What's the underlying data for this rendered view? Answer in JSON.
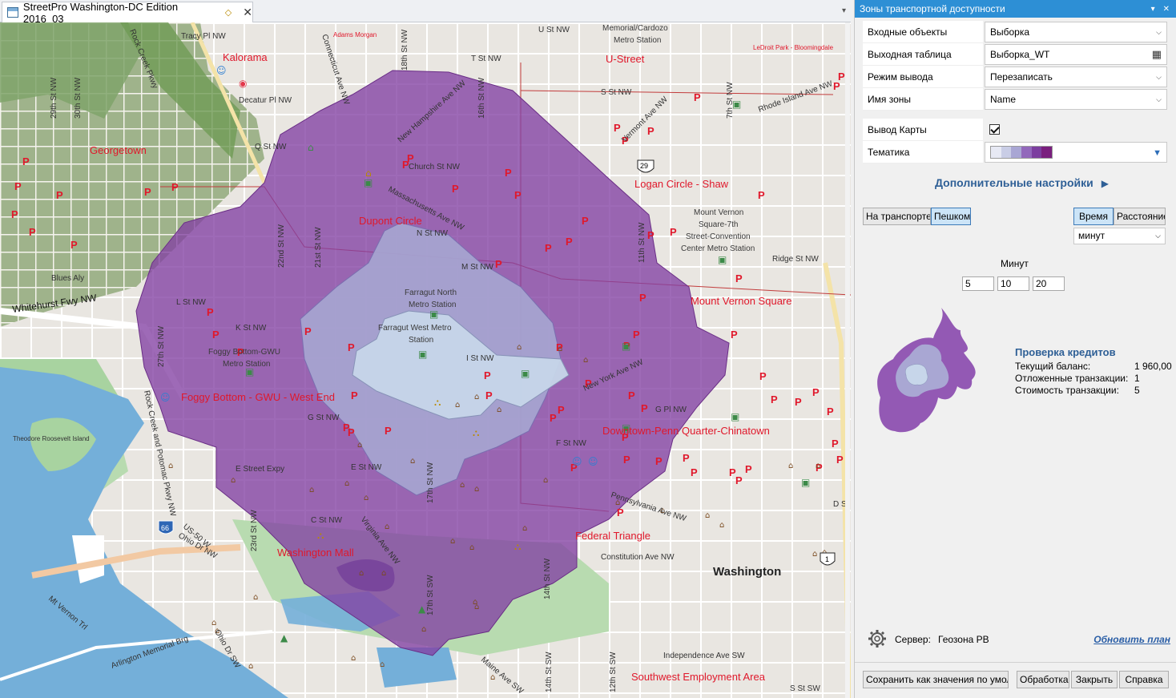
{
  "map_window": {
    "tab_title": "StreetPro Washington-DC Edition 2016_03",
    "tab_close": "✕",
    "tab_menu": "▾"
  },
  "map": {
    "neighborhoods": [
      "Kalorama",
      "Georgetown",
      "Dupont Circle",
      "Logan Circle - Shaw",
      "Mount Vernon Square",
      "Foggy Bottom - GWU - West End",
      "Downtown-Penn Quarter-Chinatown",
      "Washington Mall",
      "Federal Triangle",
      "Southwest Employment Area",
      "U-Street"
    ],
    "city": "Washington",
    "small_places": [
      "Adams Morgan",
      "LeDroit Park - Bloomingdale",
      "Theodore Roosevelt Island",
      "Blues Aly",
      "Whitehurst Fwy NW"
    ],
    "stations": [
      "Farragut North\nMetro Station",
      "Farragut West Metro\nStation",
      "Foggy Bottom-GWU\nMetro Station",
      "Memorial/Cardozo\nMetro Station",
      "Mount Vernon\nSquare-7th\nStreet-Convention\nCenter Metro Station"
    ],
    "streets": [
      "Tracy Pl NW",
      "U St NW",
      "T St NW",
      "S St NW",
      "Decatur Pl NW",
      "Q St NW",
      "Church St NW",
      "N St NW",
      "M St NW",
      "L St NW",
      "K St NW",
      "I St NW",
      "G Pl NW",
      "G St NW",
      "F St NW",
      "E St NW",
      "E Street Expy",
      "C St NW",
      "D St",
      "Massachusetts Ave NW",
      "New Hampshire Ave NW",
      "Vermont Ave NW",
      "Rhode Island Ave NW",
      "New York Ave NW",
      "Pennsylvania Ave NW",
      "Constitution Ave NW",
      "Independence Ave SW",
      "Virginia Ave NW",
      "Rock Creek and Potomac Pkwy NW",
      "Ridge St NW",
      "Ohio Dr NW",
      "Ohio Dr SW",
      "Arlington Memorial Brg",
      "Mt Vernon Trl",
      "US-50 W",
      "Maine Ave SW",
      "Connecticut Ave NW",
      "Rock Creek Pkwy",
      "16th St NW",
      "14th St NW",
      "11th St NW",
      "7th St NW",
      "17th St NW",
      "18th St NW",
      "21st St NW",
      "22nd St NW",
      "23rd St NW",
      "27th St NW",
      "14th St SW",
      "12th St SW",
      "17th St SW",
      "S St SW",
      "29th St NW",
      "30th St NW"
    ],
    "route_shields": [
      "29",
      "66",
      "1"
    ]
  },
  "panel": {
    "title": "Зоны транспортной доступности",
    "rows": [
      {
        "label": "Входные объекты",
        "value": "Выборка"
      },
      {
        "label": "Выходная таблица",
        "value": "Выборка_WT"
      },
      {
        "label": "Режим вывода",
        "value": "Перезаписать"
      },
      {
        "label": "Имя зоны",
        "value": "Name"
      }
    ],
    "map_output_label": "Вывод Карты",
    "map_output_checked": true,
    "theme_label": "Тематика",
    "theme_colors": [
      "#e7e9f4",
      "#c9cde6",
      "#a9a6d4",
      "#9268bb",
      "#7c3e9f",
      "#7a1f7e"
    ],
    "advanced_label": "Дополнительные настройки",
    "mode_buttons": [
      "На транспорте",
      "Пешком"
    ],
    "mode_active": "Пешком",
    "measure_buttons": [
      "Время",
      "Расстояние"
    ],
    "measure_active": "Время",
    "unit_value": "минут",
    "minutes_label": "Минут",
    "intervals": [
      "5",
      "10",
      "20"
    ],
    "credits": {
      "title": "Проверка кредитов",
      "rows": [
        {
          "label": "Текущий баланс:",
          "value": "1 960,00"
        },
        {
          "label": "Отложенные транзакции:",
          "value": "1"
        },
        {
          "label": "Стоимость транзакции:",
          "value": "5"
        }
      ]
    },
    "server_label": "Сервер:",
    "server_value": "Геозона РВ",
    "update_link": "Обновить план",
    "footer_buttons": [
      "Сохранить как значения по умолчанию",
      "Обработка",
      "Закрыть",
      "Справка"
    ]
  }
}
